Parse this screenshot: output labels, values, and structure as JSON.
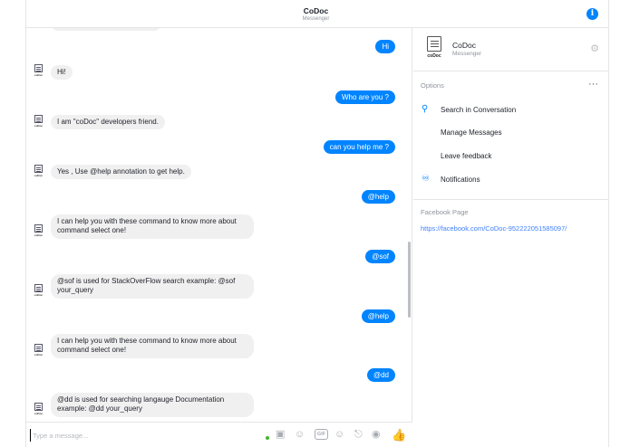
{
  "header": {
    "title": "CoDoc",
    "subtitle": "Messenger",
    "info_icon": "info-icon"
  },
  "bot": {
    "avatar_caption": "coDoc"
  },
  "messages": [
    {
      "from": "me",
      "text": "Hi"
    },
    {
      "from": "bot",
      "text": "Hi!"
    },
    {
      "from": "me",
      "text": "Who are you ?"
    },
    {
      "from": "bot",
      "text": "I am \"coDoc\" developers friend."
    },
    {
      "from": "me",
      "text": "can you help me ?"
    },
    {
      "from": "bot",
      "text": "Yes , Use @help annotation to get help."
    },
    {
      "from": "me",
      "text": "@help"
    },
    {
      "from": "bot",
      "text": "I can help you with these command to know more about command select one!"
    },
    {
      "from": "me",
      "text": "@sof"
    },
    {
      "from": "bot",
      "text": "@sof is used for StackOverFlow search example: @sof your_query"
    },
    {
      "from": "me",
      "text": "@help"
    },
    {
      "from": "bot",
      "text": "I can help you with these command to know more about command select one!"
    },
    {
      "from": "me",
      "text": "@dd"
    },
    {
      "from": "bot",
      "text": "@dd is used for searching langauge Documentation example: @dd your_query"
    }
  ],
  "composer": {
    "placeholder": "Type a message...",
    "gif_label": "GIF",
    "colors": {
      "accent": "#0084ff",
      "online": "#42b72a"
    }
  },
  "profile": {
    "name": "CoDoc",
    "subtitle": "Messenger",
    "avatar_caption": "coDoc"
  },
  "options": {
    "header": "Options",
    "items": [
      {
        "label": "Search in Conversation",
        "icon": "search-icon"
      },
      {
        "label": "Manage Messages",
        "icon": ""
      },
      {
        "label": "Leave feedback",
        "icon": ""
      },
      {
        "label": "Notifications",
        "icon": "bell-icon"
      }
    ]
  },
  "facebook_page": {
    "label": "Facebook Page",
    "url": "https://facebook.com/CoDoc-952222051585097/"
  }
}
